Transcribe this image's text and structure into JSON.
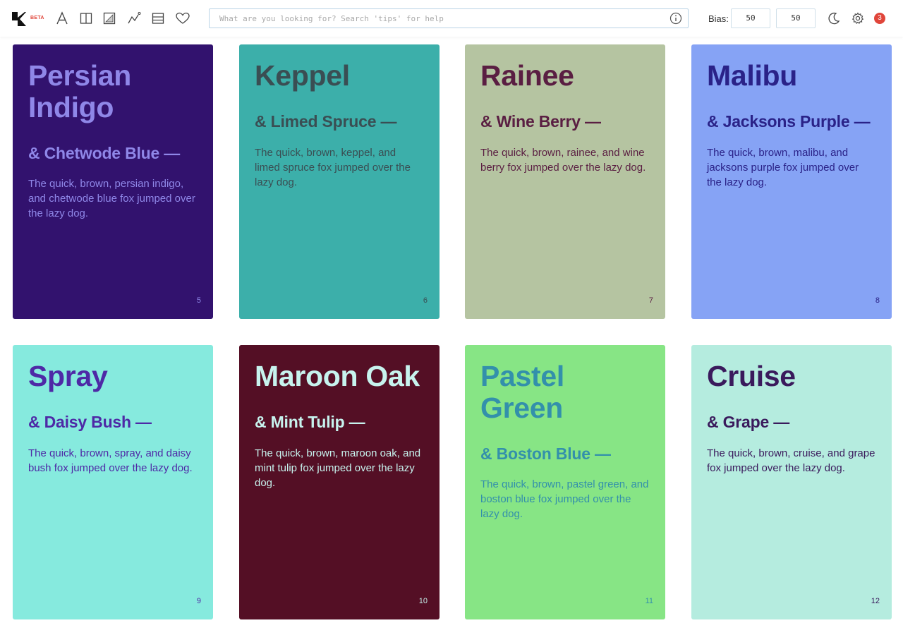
{
  "app": {
    "beta_badge": "BETA",
    "search_placeholder": "What are you looking for? Search 'tips' for help",
    "bias_label": "Bias:",
    "bias_values": [
      "50",
      "50"
    ],
    "notification_count": "3",
    "toolbar_icons": [
      "logo-icon",
      "font-icon",
      "columns-icon",
      "gradient-icon",
      "chart-icon",
      "rows-icon",
      "heart-icon"
    ]
  },
  "cards": [
    {
      "name": "Persian Indigo",
      "pair": "& Chetwode Blue —",
      "text": "The quick, brown, persian indigo, and chetwode blue fox jumped over the lazy dog.",
      "number": "5",
      "bg": "#32126e",
      "fg": "#8f87e8"
    },
    {
      "name": "Keppel",
      "pair": "& Limed Spruce —",
      "text": "The quick, brown, keppel, and limed spruce fox jumped over the lazy dog.",
      "number": "6",
      "bg": "#3cafaa",
      "fg": "#3a4e53"
    },
    {
      "name": "Rainee",
      "pair": "& Wine Berry —",
      "text": "The quick, brown, rainee, and wine berry fox jumped over the lazy dog.",
      "number": "7",
      "bg": "#b5c4a1",
      "fg": "#5a1e42"
    },
    {
      "name": "Malibu",
      "pair": "& Jacksons Purple —",
      "text": "The quick, brown, malibu, and jacksons purple fox jumped over the lazy dog.",
      "number": "8",
      "bg": "#86a3f5",
      "fg": "#2a2288"
    },
    {
      "name": "Spray",
      "pair": "& Daisy Bush —",
      "text": "The quick, brown, spray, and daisy bush fox jumped over the lazy dog.",
      "number": "9",
      "bg": "#86eade",
      "fg": "#4e29a6"
    },
    {
      "name": "Maroon Oak",
      "pair": "& Mint Tulip —",
      "text": "The quick, brown, maroon oak, and mint tulip fox jumped over the lazy dog.",
      "number": "10",
      "bg": "#540f25",
      "fg": "#c7f3ee"
    },
    {
      "name": "Pastel Green",
      "pair": "& Boston Blue —",
      "text": "The quick, brown, pastel green, and boston blue fox jumped over the lazy dog.",
      "number": "11",
      "bg": "#87e585",
      "fg": "#3390ab"
    },
    {
      "name": "Cruise",
      "pair": "& Grape —",
      "text": "The quick, brown, cruise, and grape fox jumped over the lazy dog.",
      "number": "12",
      "bg": "#b5ecdf",
      "fg": "#3a1a5c"
    }
  ]
}
